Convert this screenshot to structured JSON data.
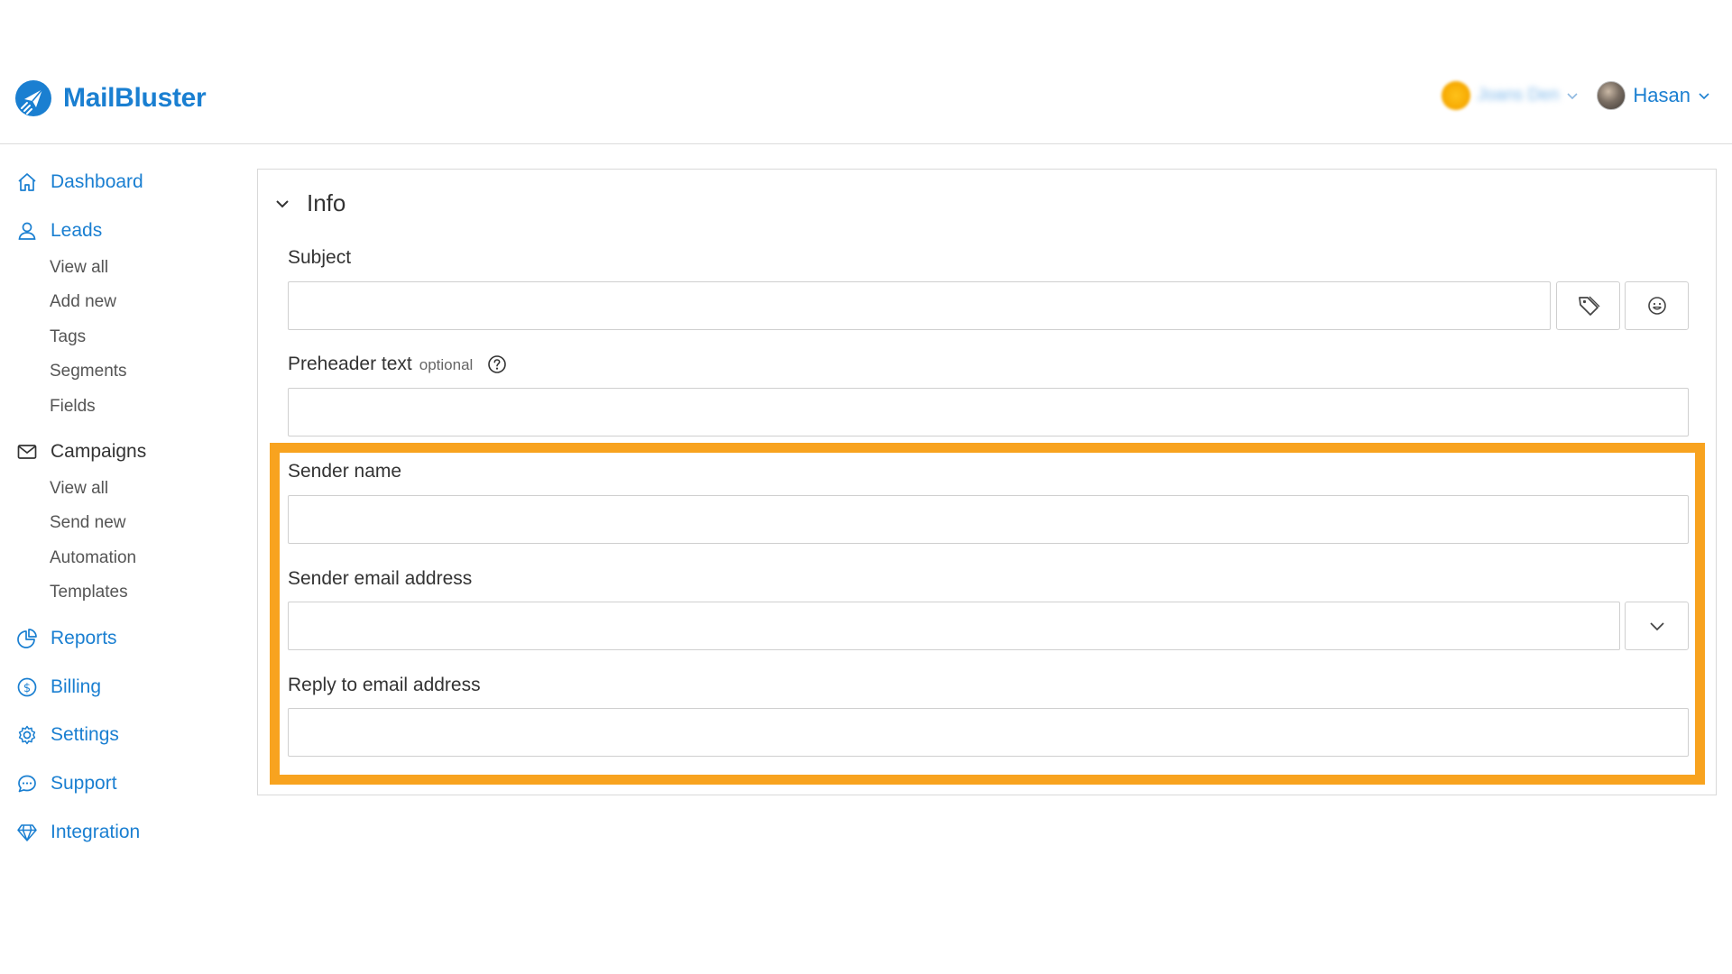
{
  "brand": {
    "name": "MailBluster",
    "logo_icon": "paper-plane-logo-icon",
    "color": "#1a7fd1"
  },
  "account": {
    "org_name": "Joans Den",
    "org_icon": "organization-avatar",
    "user_name": "Hasan",
    "user_icon": "user-avatar"
  },
  "sidebar": {
    "dashboard": "Dashboard",
    "leads": {
      "label": "Leads",
      "items": [
        "View all",
        "Add new",
        "Tags",
        "Segments",
        "Fields"
      ]
    },
    "campaigns": {
      "label": "Campaigns",
      "items": [
        "View all",
        "Send new",
        "Automation",
        "Templates"
      ]
    },
    "reports": "Reports",
    "billing": "Billing",
    "settings": "Settings",
    "support": "Support",
    "integration": "Integration"
  },
  "form": {
    "section_title": "Info",
    "subject": {
      "label": "Subject",
      "value": "",
      "placeholder": ""
    },
    "preheader": {
      "label": "Preheader text",
      "optional": "optional",
      "value": "",
      "placeholder": ""
    },
    "sender_name": {
      "label": "Sender name",
      "value": "",
      "placeholder": ""
    },
    "sender_email": {
      "label": "Sender email address",
      "value": "",
      "placeholder": ""
    },
    "reply_to": {
      "label": "Reply to email address",
      "value": "",
      "placeholder": ""
    }
  },
  "highlight_color": "#f8a31f"
}
